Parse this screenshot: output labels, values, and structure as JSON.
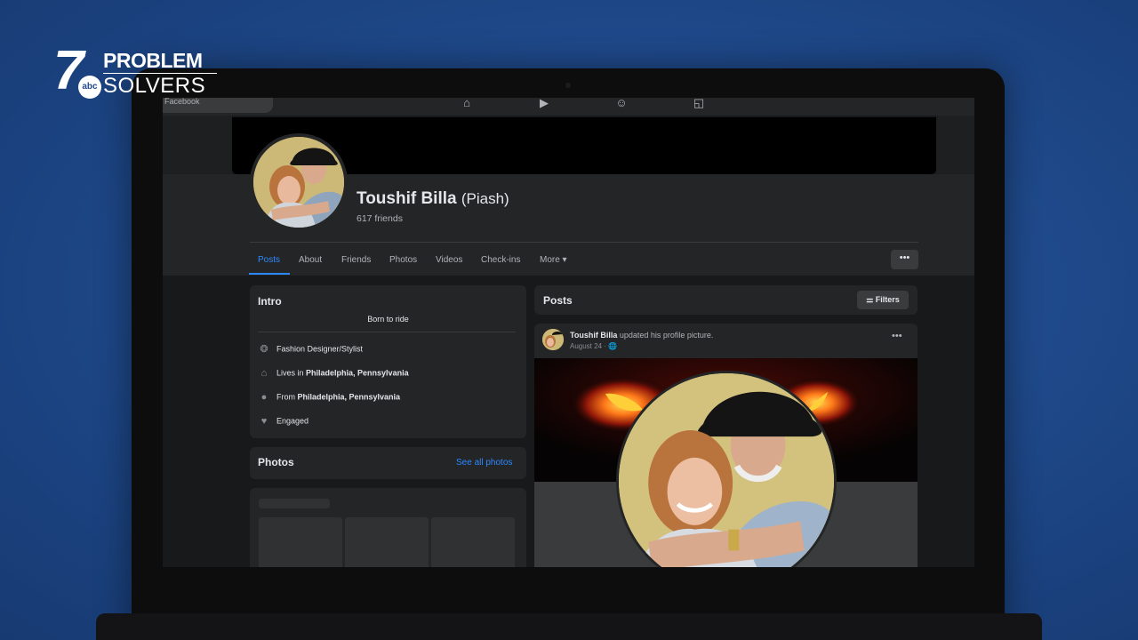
{
  "logo": {
    "number": "7",
    "network": "abc",
    "line1": "PROBLEM",
    "line2": "SOLVERS"
  },
  "topbar": {
    "search_placeholder": "Facebook",
    "nav_icons": [
      "home-icon",
      "watch-icon",
      "groups-icon",
      "gaming-icon"
    ]
  },
  "profile": {
    "name": "Toushif Billa",
    "nickname": "(Piash)",
    "friends": "617 friends"
  },
  "tabs": [
    "Posts",
    "About",
    "Friends",
    "Photos",
    "Videos",
    "Check-ins",
    "More ▾"
  ],
  "more_button": "•••",
  "intro": {
    "title": "Intro",
    "bio": "Born to ride",
    "work": "Fashion Designer/Stylist",
    "lives_prefix": "Lives in ",
    "lives_place": "Philadelphia, Pennsylvania",
    "from_prefix": "From ",
    "from_place": "Philadelphia, Pennsylvania",
    "relationship": "Engaged"
  },
  "photos": {
    "title": "Photos",
    "see_all": "See all photos"
  },
  "posts": {
    "title": "Posts",
    "filters": "Filters",
    "post": {
      "author": "Toushif Billa",
      "action": " updated his profile picture.",
      "date": "August 24 · 🌐",
      "menu": "•••"
    }
  },
  "colors": {
    "accent": "#2d88ff",
    "card": "#242526",
    "background": "#18191a"
  }
}
